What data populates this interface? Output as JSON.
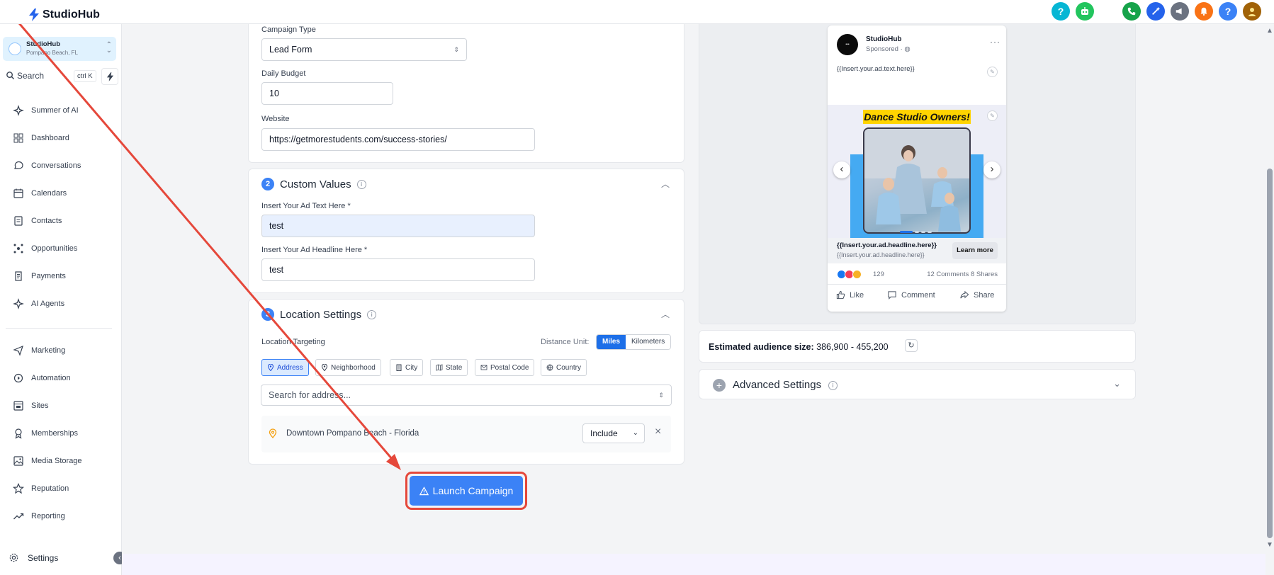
{
  "app": {
    "name": "StudioHub"
  },
  "account": {
    "name": "StudioHub",
    "city": "Pompano Beach, FL"
  },
  "search": {
    "label": "Search",
    "shortcut": "ctrl K"
  },
  "sidebar": {
    "items": [
      {
        "label": "Summer of AI",
        "icon": "sparkle-icon"
      },
      {
        "label": "Dashboard",
        "icon": "dashboard-icon"
      },
      {
        "label": "Conversations",
        "icon": "chat-icon"
      },
      {
        "label": "Calendars",
        "icon": "calendar-icon"
      },
      {
        "label": "Contacts",
        "icon": "contacts-icon"
      },
      {
        "label": "Opportunities",
        "icon": "opportunities-icon"
      },
      {
        "label": "Payments",
        "icon": "payments-icon"
      },
      {
        "label": "AI Agents",
        "icon": "sparkle-icon"
      },
      {
        "label": "Marketing",
        "icon": "send-icon"
      },
      {
        "label": "Automation",
        "icon": "automation-icon"
      },
      {
        "label": "Sites",
        "icon": "sites-icon"
      },
      {
        "label": "Memberships",
        "icon": "membership-icon"
      },
      {
        "label": "Media Storage",
        "icon": "image-icon"
      },
      {
        "label": "Reputation",
        "icon": "star-icon"
      },
      {
        "label": "Reporting",
        "icon": "trend-icon"
      }
    ],
    "settings_label": "Settings"
  },
  "campaign": {
    "type_label": "Campaign Type",
    "type_value": "Lead Form",
    "budget_label": "Daily Budget",
    "budget_value": "10",
    "website_label": "Website",
    "website_value": "https://getmorestudents.com/success-stories/"
  },
  "custom_values": {
    "number": "2",
    "title": "Custom Values",
    "ad_text_label": "Insert Your Ad Text Here *",
    "ad_text_value": "test",
    "headline_label": "Insert Your Ad Headline Here *",
    "headline_value": "test"
  },
  "location": {
    "number": "3",
    "title": "Location Settings",
    "targeting_label": "Location Targeting",
    "distance_label": "Distance Unit:",
    "units": [
      "Miles",
      "Kilometers"
    ],
    "selected_unit": "Miles",
    "types": [
      "Address",
      "Neighborhood",
      "City",
      "State",
      "Postal Code",
      "Country"
    ],
    "selected_type": "Address",
    "search_placeholder": "Search for address...",
    "result_name": "Downtown Pompano Beach - Florida",
    "result_mode": "Include"
  },
  "launch_label": "Launch Campaign",
  "preview": {
    "page_name": "StudioHub",
    "sponsored": "Sponsored",
    "ad_text": "{{Insert.your.ad.text.here}}",
    "creative_title": "Dance Studio Owners!",
    "headline": "{{Insert.your.ad.headline.here}}",
    "subheadline": "{{Insert.your.ad.headline.here}}",
    "cta": "Learn more",
    "reaction_count": "129",
    "engagement": "12 Comments 8 Shares",
    "actions": [
      "Like",
      "Comment",
      "Share"
    ]
  },
  "audience": {
    "label": "Estimated audience size:",
    "value": "386,900 - 455,200"
  },
  "advanced": {
    "title": "Advanced Settings"
  },
  "colors": {
    "primary": "#3b82f6",
    "highlight": "#e5483b",
    "banner": "#ffd400"
  }
}
